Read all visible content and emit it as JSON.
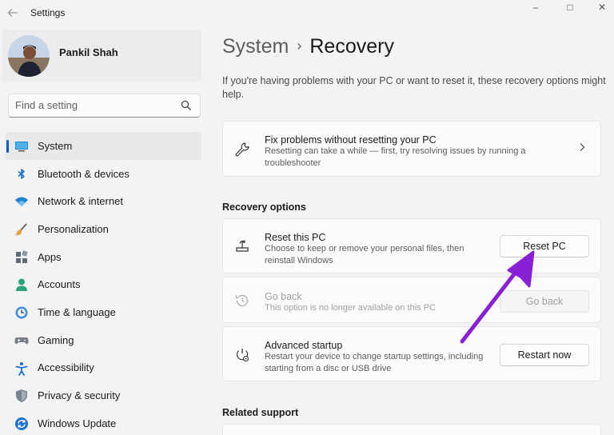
{
  "window": {
    "title": "Settings",
    "minimize": "–",
    "maximize": "□",
    "close": "✕"
  },
  "profile": {
    "name": "Pankil Shah"
  },
  "search": {
    "placeholder": "Find a setting"
  },
  "sidebar": {
    "items": [
      {
        "label": "System",
        "icon": "system-icon",
        "active": true
      },
      {
        "label": "Bluetooth & devices",
        "icon": "bluetooth-icon"
      },
      {
        "label": "Network & internet",
        "icon": "wifi-icon"
      },
      {
        "label": "Personalization",
        "icon": "brush-icon"
      },
      {
        "label": "Apps",
        "icon": "apps-icon"
      },
      {
        "label": "Accounts",
        "icon": "account-icon"
      },
      {
        "label": "Time & language",
        "icon": "globe-clock-icon"
      },
      {
        "label": "Gaming",
        "icon": "gamepad-icon"
      },
      {
        "label": "Accessibility",
        "icon": "accessibility-icon"
      },
      {
        "label": "Privacy & security",
        "icon": "shield-icon"
      },
      {
        "label": "Windows Update",
        "icon": "update-icon"
      }
    ]
  },
  "main": {
    "breadcrumb": {
      "parent": "System",
      "separator": "›",
      "current": "Recovery"
    },
    "intro": "If you're having problems with your PC or want to reset it, these recovery options might help.",
    "fix_card": {
      "title": "Fix problems without resetting your PC",
      "subtitle": "Resetting can take a while — first, try resolving issues by running a troubleshooter"
    },
    "recovery_header": "Recovery options",
    "reset": {
      "title": "Reset this PC",
      "subtitle": "Choose to keep or remove your personal files, then reinstall Windows",
      "button": "Reset PC"
    },
    "goback": {
      "title": "Go back",
      "subtitle": "This option is no longer available on this PC",
      "button": "Go back"
    },
    "advanced": {
      "title": "Advanced startup",
      "subtitle": "Restart your device to change startup settings, including starting from a disc or USB drive",
      "button": "Restart now"
    },
    "related_header": "Related support"
  },
  "colors": {
    "accent": "#005fb8",
    "annotation_arrow": "#8a1fd6"
  }
}
